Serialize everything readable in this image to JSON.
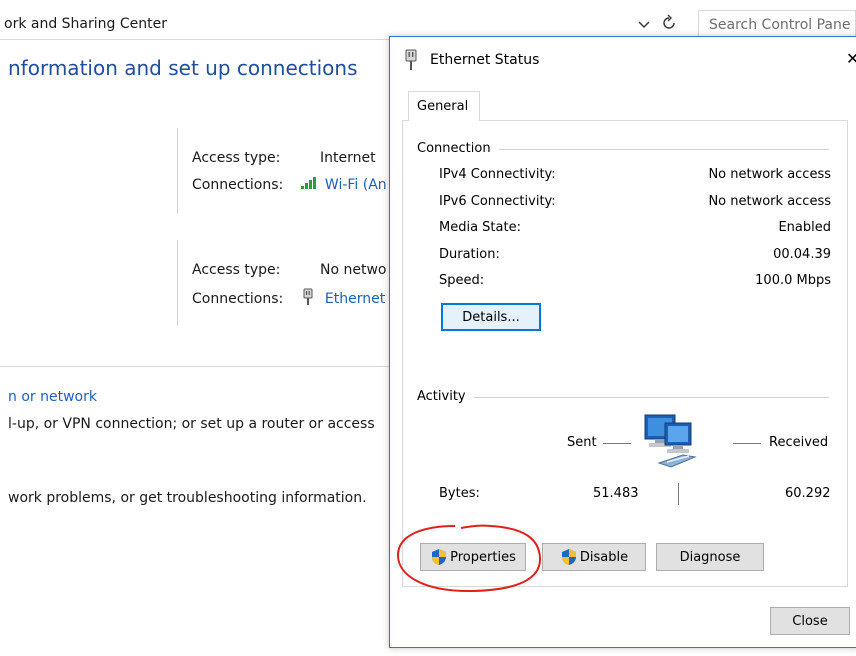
{
  "control_panel": {
    "breadcrumb": "ork and Sharing Center",
    "search_placeholder": "Search Control Pane",
    "heading": "nformation and set up connections",
    "networks": [
      {
        "access_label": "Access type:",
        "access_value": "Internet",
        "connections_label": "Connections:",
        "connection_value": "Wi-Fi (An"
      },
      {
        "access_label": "Access type:",
        "access_value": "No netwo",
        "connections_label": "Connections:",
        "connection_value": "Ethernet"
      }
    ],
    "task_link": "n or network",
    "task_desc": "l-up, or VPN connection; or set up a router or access",
    "troubleshoot_desc": "work problems, or get troubleshooting information."
  },
  "dialog": {
    "title": "Ethernet Status",
    "tab_general": "General",
    "connection_group": "Connection",
    "connection_rows": [
      {
        "label": "IPv4 Connectivity:",
        "value": "No network access"
      },
      {
        "label": "IPv6 Connectivity:",
        "value": "No network access"
      },
      {
        "label": "Media State:",
        "value": "Enabled"
      },
      {
        "label": "Duration:",
        "value": "00.04.39"
      },
      {
        "label": "Speed:",
        "value": "100.0 Mbps"
      }
    ],
    "details_button": "Details...",
    "activity_group": "Activity",
    "sent_label": "Sent",
    "received_label": "Received",
    "bytes_label": "Bytes:",
    "bytes_sent": "51.483",
    "bytes_received": "60.292",
    "properties_button": "Properties",
    "disable_button": "Disable",
    "diagnose_button": "Diagnose",
    "close_button": "Close"
  },
  "colors": {
    "link_blue": "#1e5fb8",
    "heading_blue": "#1e4e9c",
    "dialog_border": "#2b79d6",
    "button_face": "#e1e1e1",
    "annotation_red": "#e0201b",
    "wifi_green": "#2e9a3a"
  },
  "icons": {
    "title": "network-cable-icon",
    "wifi": "wifi-signal-icon",
    "ethernet": "network-cable-icon",
    "activity": "network-computers-icon",
    "uac": "uac-shield-icon",
    "refresh": "refresh-icon",
    "dropdown": "chevron-down-icon",
    "close": "close-icon"
  }
}
